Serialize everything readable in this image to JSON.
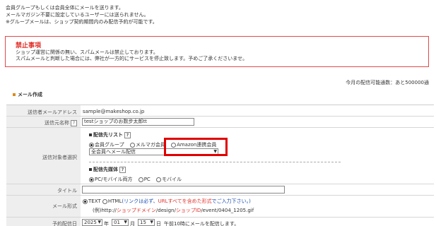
{
  "intro": {
    "line1": "会員グループもしくは会員全体にメールを送ります。",
    "line2": "メールマガジン不要に設定しているユーザーには送られません。",
    "line3": "※グループメールは、ショップ契約期間内のみ配信予約が可能です。"
  },
  "warning": {
    "title": "禁止事項",
    "line1": "ショップ運営に関係の無い、スパムメールは禁止しております。",
    "line2": "スパムメールと判断した場合には、弊社が一方的にサービスを停止致します。予めご了承くださいませ。"
  },
  "quota_text": "今月の配信可能通数：あと500000通",
  "section_title": "メール作成",
  "form": {
    "sender_address_label": "送信者メールアドレス",
    "sender_address_value": "sample@makeshop.co.jp",
    "sender_name_label": "送信元名称",
    "sender_name_value": "testショップのお数步太郎tt",
    "target_label": "送信対象者選択",
    "list_heading": "配信先リスト",
    "list_options": [
      "会員グループ",
      "メルマガ会員",
      "Amazon連携会員"
    ],
    "list_selected": "会員グループ",
    "group_select_value": "全会員へメール配信",
    "media_heading": "配信先媒体",
    "media_options": [
      "PC/モバイル両方",
      "PC",
      "モバイル"
    ],
    "media_selected": "PC/モバイル両方",
    "title_label": "タイトル",
    "title_value": "",
    "format_label": "メール形式",
    "format_text": "TEXT",
    "format_html": "HTML",
    "format_note_prefix": "(リンクは必ず、",
    "format_note_url": "URLすべてを含めた形式",
    "format_note_suffix": "でご入力下さい。)",
    "format_example_prefix": "(例)http://",
    "format_example_shop": "ショップドメイン",
    "format_example_mid": "/design/",
    "format_example_id": "ショップID",
    "format_example_suffix": "/event/0404_1205.gif",
    "schedule_label": "予約配信日",
    "year": "2025",
    "year_unit": "年",
    "month": "01",
    "month_unit": "月",
    "day": "15",
    "day_unit": "日",
    "schedule_note": "午前10時にメールを配信します。",
    "help_mark": "?"
  },
  "colors": {
    "warning_border": "#e24a4a",
    "warning_title": "#e0302a",
    "highlight": "#e00000",
    "label_bg": "#eeeeee"
  }
}
